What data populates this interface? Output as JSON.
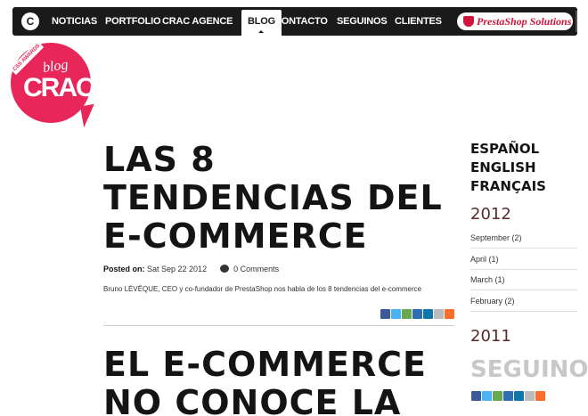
{
  "nav": {
    "items": [
      {
        "label": "NOTICIAS"
      },
      {
        "label": "PORTFOLIO"
      },
      {
        "label": "CRAC AGENCE"
      },
      {
        "label": "BLOG"
      },
      {
        "label": "CONTACTO"
      },
      {
        "label": "SEGUINOS"
      },
      {
        "label": "CLIENTES"
      }
    ],
    "active": "BLOG",
    "logo_glyph": "C",
    "prestashop_label": "PrestaShop Solutions"
  },
  "badge": {
    "ribbon_text": "CSS AWARDS",
    "blog_text": "blog",
    "logo_text": "CRAC"
  },
  "article": {
    "title": "LAS 8 TENDENCIAS DEL E-COMMERCE",
    "posted_label": "Posted on:",
    "date": "Sat Sep 22 2012",
    "comments": "0 Comments",
    "excerpt": "Bruno LÉVÊQUE, CEO y co-fundador de PrestaShop nos habla de los 8 tendencias del e-commerce"
  },
  "next_article": {
    "title": "EL E-COMMERCE NO CONOCE LA"
  },
  "sidebar": {
    "languages": [
      "ESPAÑOL",
      "ENGLISH",
      "FRANÇAIS"
    ],
    "archive": [
      {
        "year": "2012",
        "months": [
          "September (2)",
          "April (1)",
          "March (1)",
          "February (2)"
        ]
      },
      {
        "year": "2011",
        "months": []
      }
    ],
    "follow_label": "SEGUINO"
  },
  "share_icons": [
    "facebook-icon",
    "twitter-icon",
    "google-icon",
    "digg-icon",
    "linkedin-icon",
    "email-icon",
    "addthis-icon"
  ],
  "colors": {
    "nav_bg": "#1a1a1a",
    "brand_pink": "#e8265a",
    "prestashop_red": "#d0143b",
    "year_color": "#5a2a30",
    "follow_grey": "#c8c8c8"
  }
}
